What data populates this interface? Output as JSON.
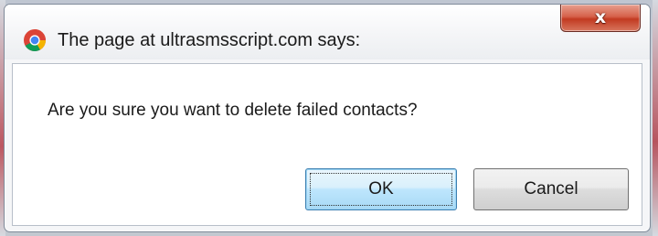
{
  "dialog": {
    "title": "The page at ultrasmsscript.com says:",
    "app_icon": "chrome-icon",
    "close_glyph": "x",
    "message": "Are you sure you want to delete failed contacts?",
    "buttons": {
      "ok_label": "OK",
      "cancel_label": "Cancel"
    }
  },
  "colors": {
    "close_button": "#c23a21",
    "ok_focus_border": "#3c7fb1",
    "dialog_background": "#f5f6f8",
    "body_background": "#ffffff"
  }
}
